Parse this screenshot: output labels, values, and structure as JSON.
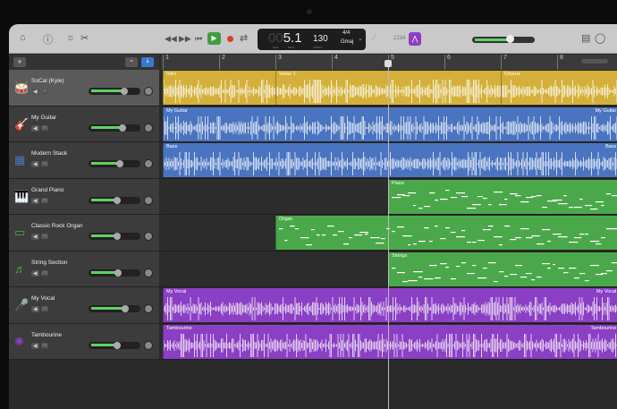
{
  "toolbar": {
    "icons": [
      "library-icon",
      "help-icon",
      "smart-controls-icon",
      "editors-icon",
      "rewind-icon",
      "fast-forward-icon",
      "go-to-beginning-icon",
      "play-icon",
      "record-icon",
      "cycle-icon",
      "metronome-icon",
      "count-in-icon",
      "tuner-icon",
      "notepad-icon",
      "loop-browser-icon"
    ],
    "lcd": {
      "bar_prefix": "00",
      "position": "5.1",
      "bar_label": "BAR",
      "beat_label": "BEAT",
      "tempo": "130",
      "tempo_label": "TEMPO",
      "signature": "4/4",
      "key": "Gmaj"
    },
    "count_in": "1234",
    "master_volume": 0.55
  },
  "ruler": {
    "bars": [
      "1",
      "2",
      "3",
      "4",
      "5",
      "6",
      "7",
      "8"
    ],
    "playhead_bar": 5
  },
  "tracks": [
    {
      "name": "SoCal (Kyle)",
      "icon": "drum-kit-icon",
      "color": "#d4b03a",
      "volume": 0.72,
      "selected": true
    },
    {
      "name": "My Guitar",
      "icon": "guitar-icon",
      "color": "#4a74c0",
      "volume": 0.68
    },
    {
      "name": "Modern Stack",
      "icon": "bass-amp-icon",
      "color": "#4a74c0",
      "volume": 0.62
    },
    {
      "name": "Grand Piano",
      "icon": "piano-icon",
      "color": "#4aa84a",
      "volume": 0.55
    },
    {
      "name": "Classic Rock Organ",
      "icon": "organ-icon",
      "color": "#4aa84a",
      "volume": 0.55
    },
    {
      "name": "String Section",
      "icon": "strings-icon",
      "color": "#4aa84a",
      "volume": 0.58
    },
    {
      "name": "My Vocal",
      "icon": "microphone-icon",
      "color": "#8a3fc4",
      "volume": 0.74
    },
    {
      "name": "Tambourine",
      "icon": "tambourine-icon",
      "color": "#8a3fc4",
      "volume": 0.55
    }
  ],
  "regions": [
    {
      "track": 0,
      "label": "Intro",
      "start": 1,
      "end": 3,
      "kind": "audio",
      "color": "#d4b03a"
    },
    {
      "track": 0,
      "label": "Verse 1",
      "start": 3,
      "end": 7,
      "kind": "audio",
      "color": "#d4b03a"
    },
    {
      "track": 0,
      "label": "Chorus",
      "start": 7,
      "end": 9.1,
      "kind": "audio",
      "color": "#d4b03a"
    },
    {
      "track": 1,
      "label": "My Guitar",
      "label_right": "My Guitar",
      "start": 1,
      "end": 9.1,
      "kind": "audio",
      "color": "#4a74c0"
    },
    {
      "track": 2,
      "label": "Bass",
      "label_right": "Bass",
      "start": 1,
      "end": 9.1,
      "kind": "audio",
      "color": "#4a74c0"
    },
    {
      "track": 3,
      "label": "Piano",
      "start": 5,
      "end": 9.1,
      "kind": "midi",
      "color": "#4aa84a"
    },
    {
      "track": 4,
      "label": "Organ",
      "start": 3,
      "end": 9.1,
      "kind": "midi",
      "color": "#4aa84a"
    },
    {
      "track": 5,
      "label": "Strings",
      "start": 5,
      "end": 9.1,
      "kind": "midi",
      "color": "#4aa84a"
    },
    {
      "track": 6,
      "label": "My Vocal",
      "label_right": "My Vocal",
      "start": 1,
      "end": 9.1,
      "kind": "audio",
      "color": "#8a3fc4"
    },
    {
      "track": 7,
      "label": "Tambourine",
      "label_right": "Tambourine",
      "start": 1,
      "end": 9.1,
      "kind": "audio",
      "color": "#8a3fc4"
    }
  ]
}
